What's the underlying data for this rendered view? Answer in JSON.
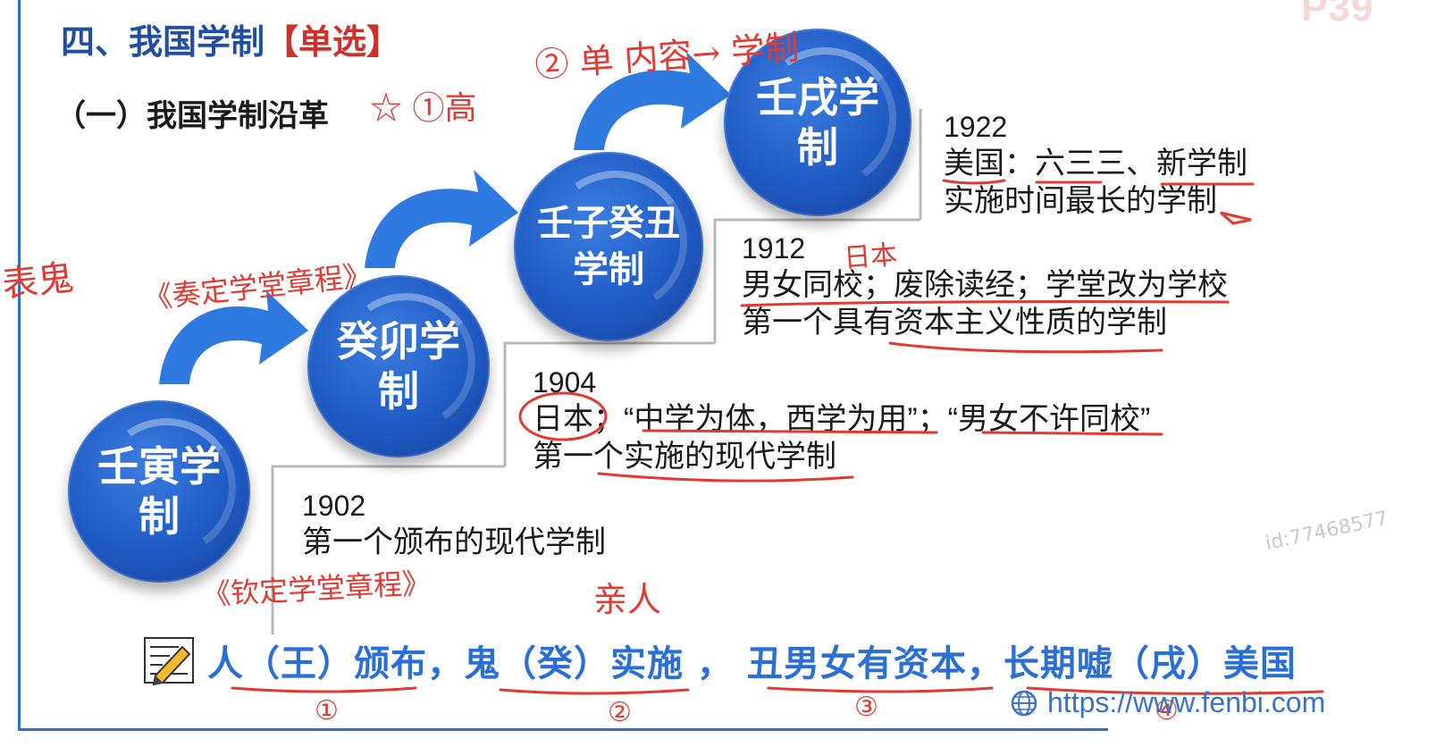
{
  "page_number": "P39",
  "title": {
    "main": "四、我国学制",
    "tag": "【单选】"
  },
  "subtitle": "（一）我国学制沿革",
  "systems": [
    {
      "label": "壬寅学制"
    },
    {
      "label": "癸卯学制"
    },
    {
      "label": "壬子癸丑学制"
    },
    {
      "label": "壬戌学制"
    }
  ],
  "events": [
    {
      "year": "1902",
      "lines": [
        "第一个颁布的现代学制"
      ]
    },
    {
      "year": "1904",
      "lines": [
        "日本；“中学为体，西学为用”；“男女不许同校”",
        "第一个实施的现代学制"
      ]
    },
    {
      "year": "1912",
      "lines": [
        "男女同校；废除读经；学堂改为学校",
        "第一个具有资本主义性质的学制"
      ]
    },
    {
      "year": "1922",
      "lines": [
        "美国：六三三、新学制",
        "实施时间最长的学制"
      ]
    }
  ],
  "mnemonic": "人（王）颁布，鬼（癸）实施 ， 丑男女有资本，长期嘘（戌）美国",
  "footer_url": "https://www.fenbi.com",
  "watermark": "id:77468577",
  "annotations": {
    "star_high": "☆ ①高",
    "single_content": "② 单  内容→ 学制",
    "biaogui": "表鬼",
    "zouding": "《奏定学堂章程》",
    "qinding": "《钦定学堂章程》",
    "qinren": "亲人",
    "japan": "日本",
    "circle_nums": [
      "①",
      "②",
      "③",
      "④"
    ]
  },
  "colors": {
    "title_blue": "#1f4ea3",
    "tag_red": "#d0302a",
    "circle_blue": "#1f5bc4",
    "arrow_blue": "#2f7ae0",
    "ink_red": "#e23a32",
    "mnemonic_blue": "#2a6fd6"
  },
  "icons": {
    "pencil": "pencil-note-icon",
    "globe": "globe-icon"
  }
}
